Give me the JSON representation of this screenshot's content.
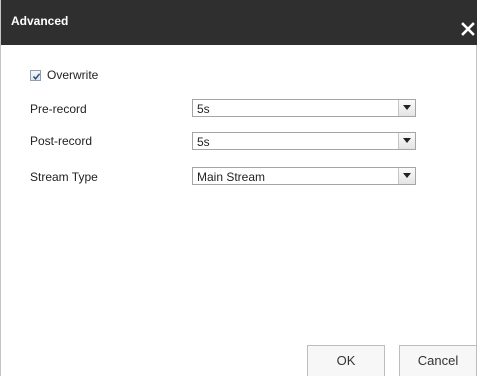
{
  "dialog": {
    "title": "Advanced",
    "close_icon": "close-icon"
  },
  "overwrite": {
    "label": "Overwrite",
    "checked": true
  },
  "fields": {
    "pre_record": {
      "label": "Pre-record",
      "value": "5s"
    },
    "post_record": {
      "label": "Post-record",
      "value": "5s"
    },
    "stream_type": {
      "label": "Stream Type",
      "value": "Main Stream"
    }
  },
  "buttons": {
    "ok_label": "OK",
    "cancel_label": "Cancel"
  },
  "colors": {
    "titlebar": "#2f2f2f",
    "title_text": "#ffffff"
  }
}
